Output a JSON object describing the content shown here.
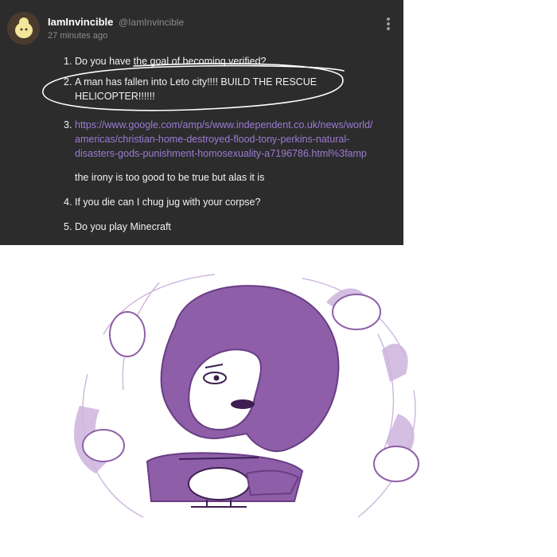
{
  "post": {
    "username": "IamInvincible",
    "handle": "@IamInvincible",
    "timestamp": "27 minutes ago",
    "items": [
      {
        "num": "1.",
        "text": "Do you have the goal of becoming verified?"
      },
      {
        "num": "2.",
        "text": "A man has fallen into Leto city!!!! BUILD THE RESCUE HELICOPTER!!!!!!"
      },
      {
        "num": "3.",
        "link_lines": [
          "https://www.google.com/amp/s/www.independent.co.uk/news/world/",
          "americas/christian-home-destroyed-flood-tony-perkins-natural-",
          "disasters-gods-punishment-homosexuality-a7196786.html%3famp"
        ],
        "note": "the irony is too good to be true but alas it is"
      },
      {
        "num": "4.",
        "text": "If you die can I chug jug with your corpse?"
      },
      {
        "num": "5.",
        "text": "Do you play Minecraft"
      }
    ]
  },
  "colors": {
    "post_bg": "#2c2c2c",
    "link": "#9b7bd4",
    "art_purple": "#8e5fa8",
    "art_light": "#cdb4dd"
  },
  "icons": [
    "avatar-image",
    "kebab-menu-icon"
  ]
}
